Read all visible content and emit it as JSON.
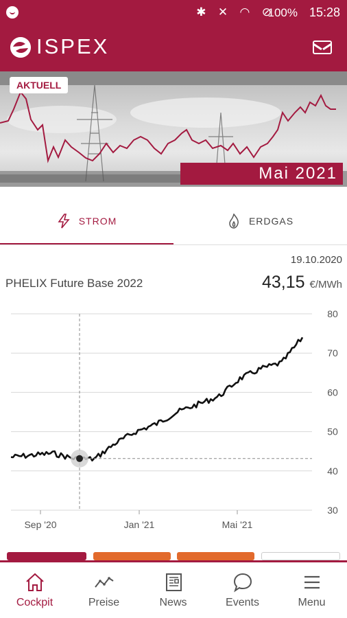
{
  "status_bar": {
    "battery": "100%",
    "time": "15:28",
    "icons": [
      "bluetooth-icon",
      "mute-icon",
      "wifi-icon",
      "dnd-icon",
      "battery-icon"
    ]
  },
  "app": {
    "name": "ISPEX"
  },
  "banner": {
    "badge": "AKTUELL",
    "month": "Mai 2021"
  },
  "tabs": [
    {
      "label": "STROM",
      "icon": "lightning-icon"
    },
    {
      "label": "ERDGAS",
      "icon": "flame-icon"
    }
  ],
  "product": {
    "date": "19.10.2020",
    "name": "PHELIX Future Base 2022",
    "price": "43,15",
    "unit": "€/MWh"
  },
  "chart_data": {
    "type": "line",
    "x_ticks": [
      "Sep '20",
      "Jan '21",
      "Mai '21"
    ],
    "y_ticks": [
      80,
      70,
      60,
      50,
      40,
      30
    ],
    "ylim": [
      30,
      80
    ],
    "x": [
      "Aug '20",
      "Sep '20",
      "Oct '20",
      "Oct '20",
      "Nov '20",
      "Dec '20",
      "Jan '21",
      "Feb '21",
      "Mar '21",
      "Apr '21",
      "Apr '21",
      "May '21",
      "May '21",
      "Jun '21",
      "Jul '21"
    ],
    "values": [
      43.5,
      44.0,
      44.5,
      43.2,
      43.0,
      47.0,
      50.0,
      52.0,
      55.0,
      57.0,
      59.0,
      63.5,
      66.0,
      67.5,
      74.0
    ],
    "marker": {
      "label": "19.10.2020",
      "value": 43.15
    },
    "colors": {
      "line": "#111111",
      "grid": "#d8d8d8",
      "marker_line": "#888888"
    }
  },
  "nav": [
    {
      "label": "Cockpit",
      "icon": "home-icon"
    },
    {
      "label": "Preise",
      "icon": "trend-icon"
    },
    {
      "label": "News",
      "icon": "newspaper-icon"
    },
    {
      "label": "Events",
      "icon": "chat-icon"
    },
    {
      "label": "Menu",
      "icon": "menu-icon"
    }
  ],
  "theme": {
    "accent": "#a31a40"
  }
}
